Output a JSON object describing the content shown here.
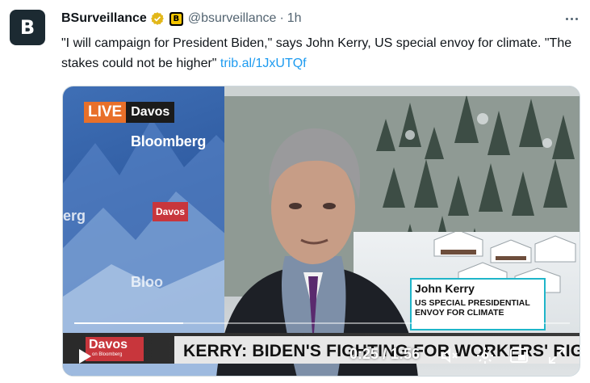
{
  "author": {
    "avatar_letter": "B",
    "name": "BSurveillance",
    "handle": "@bsurveillance",
    "separator": "·",
    "time": "1h",
    "affiliate_badge": "B"
  },
  "tweet": {
    "text": "\"I will campaign for President Biden,\" says John Kerry, US special envoy for climate. \"The stakes could not be higher\" ",
    "link_text": "trib.al/1JxUTQf"
  },
  "video": {
    "live_label": "LIVE",
    "live_location": "Davos",
    "brand_word": "Bloomberg",
    "brand_word_partial": "Bloo",
    "brand_fragment": "erg",
    "wall_chip": "Davos",
    "lower_third_name": "John Kerry",
    "lower_third_title": "US SPECIAL PRESIDENTIAL ENVOY FOR CLIMATE",
    "ticker_logo_title": "Davos",
    "ticker_logo_sub": "on Bloomberg",
    "headline": "KERRY: BIDEN'S FIGHTING FOR WORKERS' RIGHTS",
    "timecode": "0:25 / 1:56",
    "progress_fraction": 0.22
  },
  "colors": {
    "link": "#1d9bf0",
    "verified": "#e2b719",
    "live_orange": "#e8702a",
    "chip_red": "#c8363c",
    "lower_third_border": "#1fb5c9"
  },
  "icons": [
    "verified-badge-icon",
    "more-icon",
    "play-icon",
    "volume-icon",
    "settings-icon",
    "pip-icon",
    "fullscreen-icon"
  ]
}
